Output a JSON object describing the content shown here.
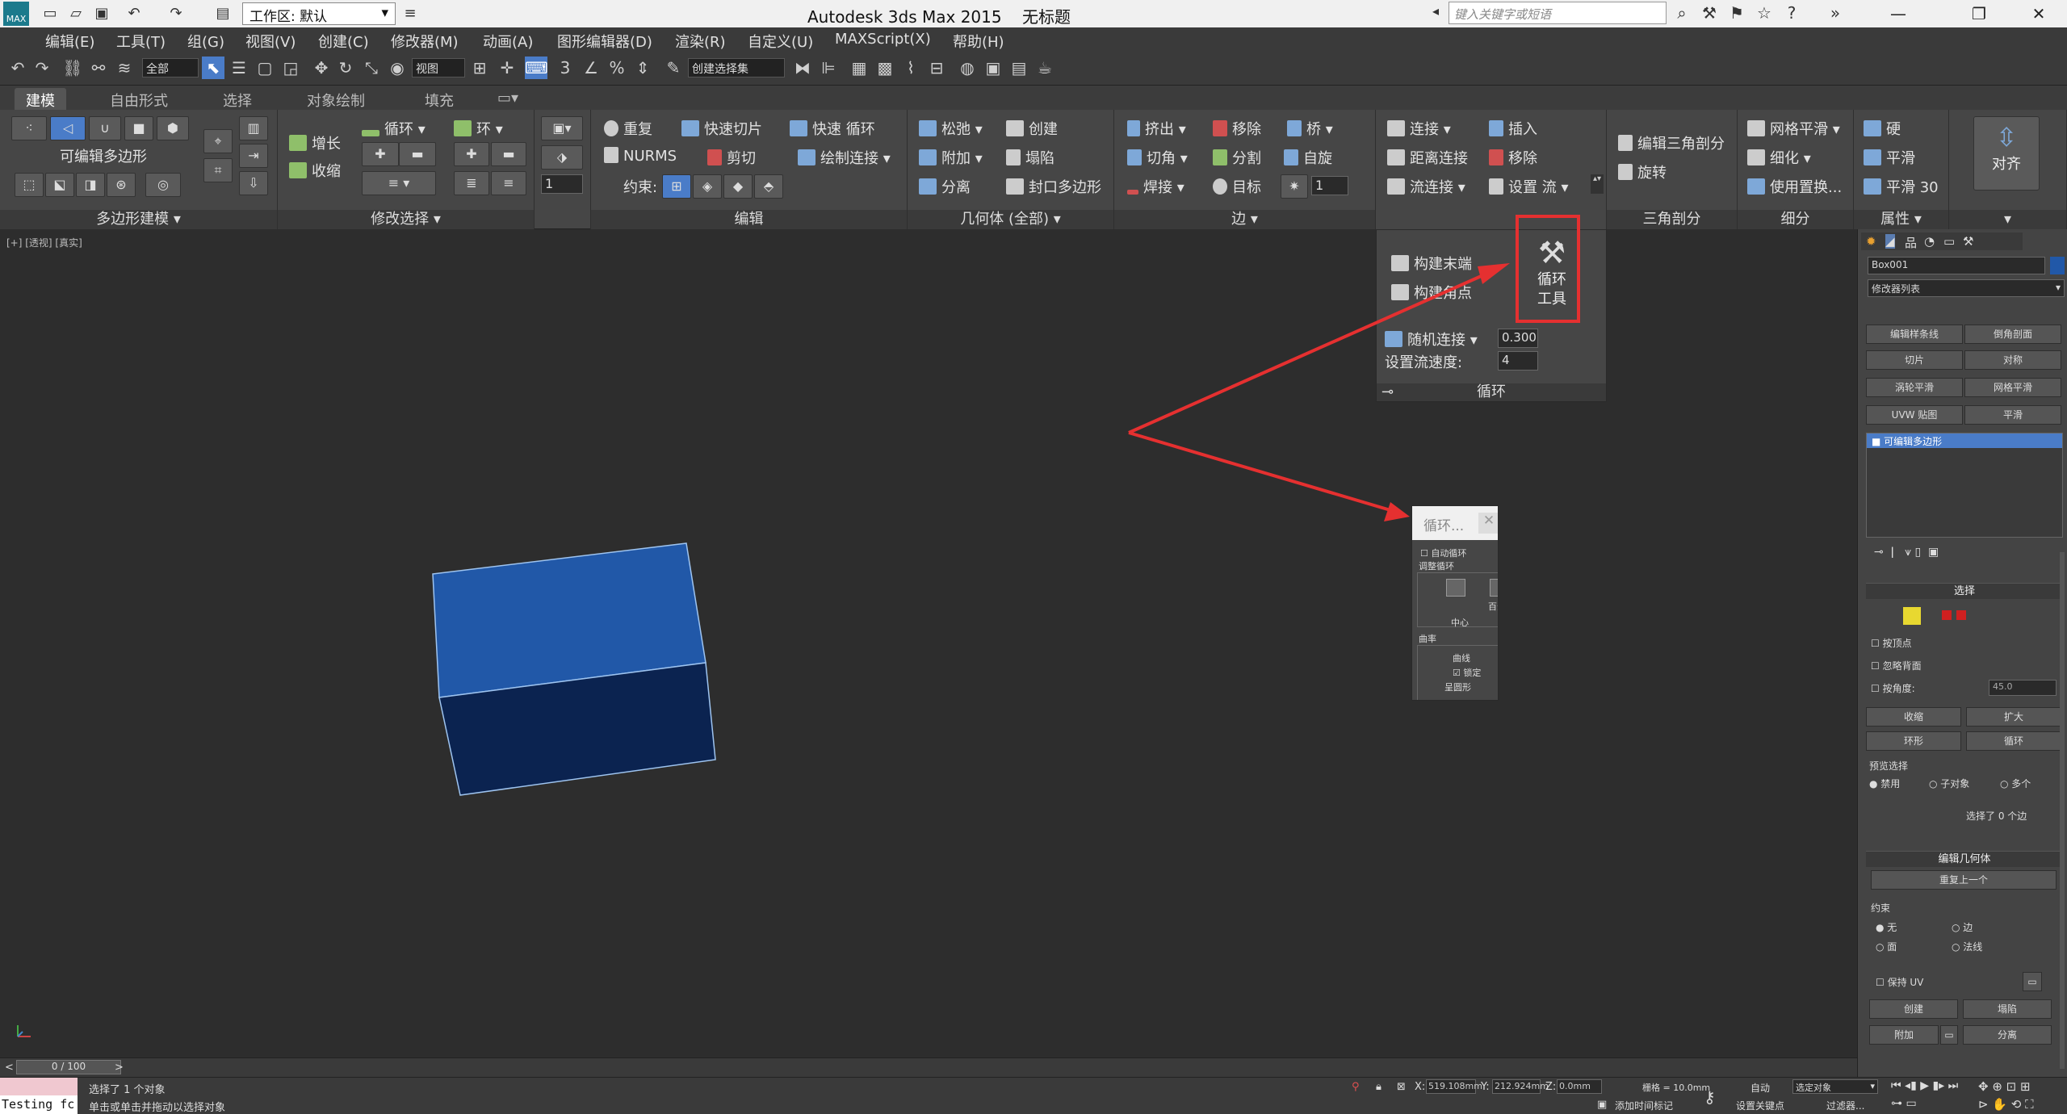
{
  "titlebar": {
    "app_title": "Autodesk 3ds Max  2015",
    "doc_title": "无标题",
    "workspace": "工作区: 默认",
    "search_placeholder": "键入关键字或短语",
    "logo_text": "MAX"
  },
  "menu": [
    "编辑(E)",
    "工具(T)",
    "组(G)",
    "视图(V)",
    "创建(C)",
    "修改器(M)",
    "动画(A)",
    "图形编辑器(D)",
    "渲染(R)",
    "自定义(U)",
    "MAXScript(X)",
    "帮助(H)"
  ],
  "toolbar": {
    "selection_filter": "全部",
    "ref_coord": "视图",
    "named_set": "创建选择集"
  },
  "ribbon_tabs": [
    "建模",
    "自由形式",
    "选择",
    "对象绘制",
    "填充"
  ],
  "ribbon": {
    "polymodel": {
      "label": "可编辑多边形",
      "footer": "多边形建模"
    },
    "modsel": {
      "grow": "增长",
      "shrink": "收缩",
      "loop": "循环",
      "ring": "环",
      "spin": "1",
      "footer": "修改选择"
    },
    "edit": {
      "repeat": "重复",
      "quickslice": "快速切片",
      "quickloop": "快速 循环",
      "nurms": "NURMS",
      "cut": "剪切",
      "paintconnect": "绘制连接",
      "constraint": "约束:",
      "footer": "编辑"
    },
    "geometry": {
      "relax": "松弛",
      "create": "创建",
      "attach": "附加",
      "collapse": "塌陷",
      "detach": "分离",
      "cap": "封口多边形",
      "footer": "几何体 (全部)"
    },
    "edges": {
      "extrude": "挤出",
      "remove": "移除",
      "bridge": "桥",
      "chamfer": "切角",
      "split": "分割",
      "spin": "自旋",
      "weld": "焊接",
      "target": "目标",
      "spinval": "1",
      "footer": "边"
    },
    "loops": {
      "connect": "连接",
      "insert": "插入",
      "distconnect": "距离连接",
      "remove": "移除",
      "flowconnect": "流连接",
      "setflow": "设置 流",
      "footer": "循环"
    },
    "tris": {
      "edittri": "编辑三角剖分",
      "rotate": "旋转",
      "footer": "三角剖分"
    },
    "subdiv": {
      "meshsmooth": "网格平滑",
      "tessellate": "细化",
      "usedisplace": "使用置换...",
      "footer": "细分"
    },
    "props": {
      "hard": "硬",
      "smooth": "平滑",
      "smooth30": "平滑 30",
      "footer": "属性"
    },
    "align": {
      "label": "对齐"
    }
  },
  "flyout": {
    "buildend": "构建末端",
    "buildcorner": "构建角点",
    "looptools": "循环\n工具",
    "randconnect": "随机连接",
    "randval": "0.300",
    "setflowspeed": "设置流速度:",
    "flowval": "4",
    "footer": "循环"
  },
  "dialog": {
    "title": "循环...",
    "autoloop": "自动循环",
    "adjust": "调整循环",
    "percent": "百分",
    "center": "中心",
    "curvature": "曲率",
    "curve": "曲线",
    "lock": "锁定",
    "circle": "呈圆形"
  },
  "viewport": {
    "label": "[+] [透视] [真实]"
  },
  "cmdpanel": {
    "objname": "Box001",
    "modlist": "修改器列表",
    "btns": [
      "编辑样条线",
      "倒角剖面",
      "切片",
      "对称",
      "涡轮平滑",
      "网格平滑",
      "UVW 贴图",
      "平滑"
    ],
    "stack_item": "可编辑多边形",
    "sel_head": "选择",
    "by_vertex": "按顶点",
    "ignore_back": "忽略背面",
    "by_angle": "按角度:",
    "angle_val": "45.0",
    "shrink": "收缩",
    "grow": "扩大",
    "ring": "环形",
    "loop": "循环",
    "preview": "预览选择",
    "off": "禁用",
    "subobj": "子对象",
    "multi": "多个",
    "selcount": "选择了 0 个边",
    "editgeo_head": "编辑几何体",
    "repeat_last": "重复上一个",
    "constraints": "约束",
    "none": "无",
    "edge": "边",
    "face": "面",
    "normal": "法线",
    "preserve_uv": "保持 UV",
    "create": "创建",
    "collapse": "塌陷",
    "attach": "附加",
    "detach": "分离"
  },
  "timeline": {
    "frame": "0 / 100"
  },
  "status": {
    "script_text": "Testing fc",
    "selected": "选择了 1 个对象",
    "prompt": "单击或单击并拖动以选择对象",
    "x": "519.108mm",
    "y": "212.924mm",
    "z": "0.0mm",
    "grid": "栅格 = 10.0mm",
    "auto": "自动",
    "sel_obj": "选定对象",
    "setkey": "设置关键点",
    "filters": "过滤器...",
    "addtime": "添加时间标记"
  },
  "colors": {
    "box_top": "#2158a8",
    "box_front": "#0b2350",
    "arrow": "#e53030",
    "accent": "#4a7cc8"
  }
}
